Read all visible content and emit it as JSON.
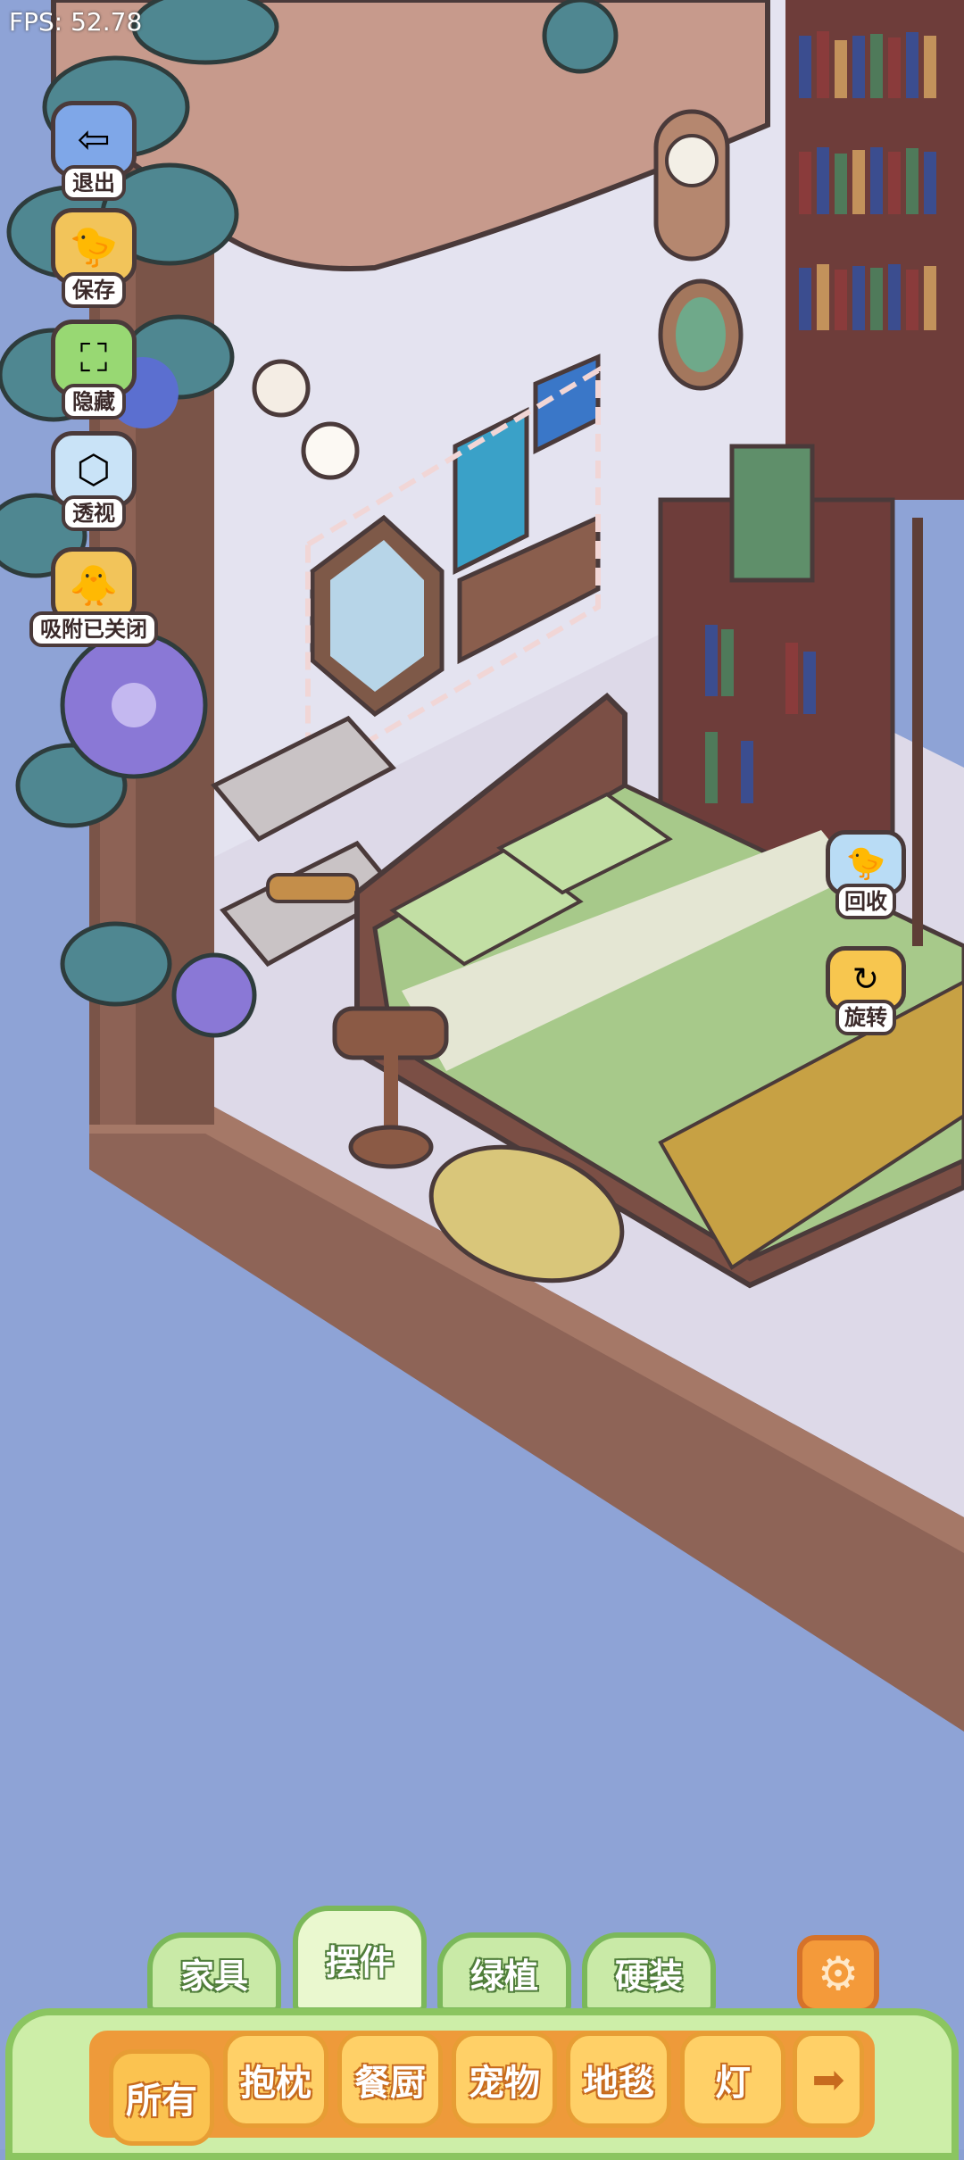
{
  "hud": {
    "fps": "FPS: 52.78"
  },
  "left_toolbar": [
    {
      "label": "退出",
      "icon": "exit-arrow-icon",
      "color": "#7fa7e8"
    },
    {
      "label": "保存",
      "icon": "chick-save-icon",
      "color": "#f2c45a"
    },
    {
      "label": "隐藏",
      "icon": "hide-frame-icon",
      "color": "#98d873"
    },
    {
      "label": "透视",
      "icon": "perspective-cube-icon",
      "color": "#c9e3f7"
    },
    {
      "label": "吸附已关闭",
      "icon": "snap-chicks-icon",
      "color": "#f2c45a"
    }
  ],
  "right_actions": [
    {
      "label": "回收",
      "icon": "recycle-chick-icon",
      "color": "#b9dcf5"
    },
    {
      "label": "旋转",
      "icon": "rotate-icon",
      "color": "#f7c64f"
    }
  ],
  "category_tabs": [
    {
      "label": "家具",
      "active": false
    },
    {
      "label": "摆件",
      "active": true
    },
    {
      "label": "绿植",
      "active": false
    },
    {
      "label": "硬装",
      "active": false
    }
  ],
  "settings_icon": "gear-icon",
  "subcategories": [
    {
      "label": "所有",
      "active": true
    },
    {
      "label": "抱枕",
      "active": false
    },
    {
      "label": "餐厨",
      "active": false
    },
    {
      "label": "宠物",
      "active": false
    },
    {
      "label": "地毯",
      "active": false
    },
    {
      "label": "灯",
      "active": false
    }
  ],
  "next_icon": "arrow-right-icon"
}
